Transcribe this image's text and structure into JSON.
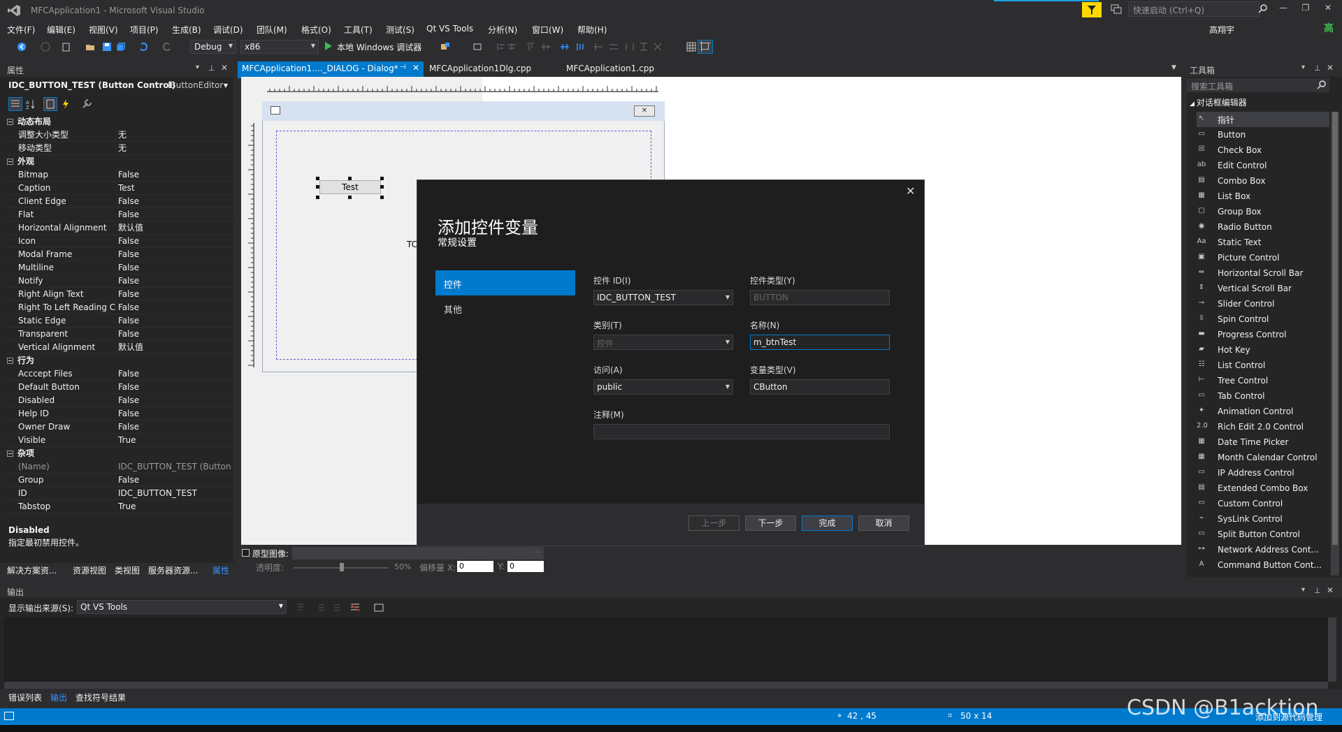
{
  "window": {
    "title": "MFCApplication1 - Microsoft Visual Studio",
    "quick_launch": "快速启动 (Ctrl+Q)",
    "user": "高翔宇",
    "avatar": "高"
  },
  "menu": [
    "文件(F)",
    "编辑(E)",
    "视图(V)",
    "项目(P)",
    "生成(B)",
    "调试(D)",
    "团队(M)",
    "格式(O)",
    "工具(T)",
    "测试(S)",
    "Qt VS Tools",
    "分析(N)",
    "窗口(W)",
    "帮助(H)"
  ],
  "toolbar": {
    "config": "Debug",
    "platform": "x86",
    "run": "本地 Windows 调试器"
  },
  "properties": {
    "header": "属性",
    "object": "IDC_BUTTON_TEST (Button Control)",
    "editor": "IButtonEditor",
    "categories": [
      {
        "name": "动态布局",
        "rows": [
          [
            "调整大小类型",
            "无"
          ],
          [
            "移动类型",
            "无"
          ]
        ]
      },
      {
        "name": "外观",
        "rows": [
          [
            "Bitmap",
            "False"
          ],
          [
            "Caption",
            "Test"
          ],
          [
            "Client Edge",
            "False"
          ],
          [
            "Flat",
            "False"
          ],
          [
            "Horizontal Alignment",
            "默认值"
          ],
          [
            "Icon",
            "False"
          ],
          [
            "Modal Frame",
            "False"
          ],
          [
            "Multiline",
            "False"
          ],
          [
            "Notify",
            "False"
          ],
          [
            "Right Align Text",
            "False"
          ],
          [
            "Right To Left Reading C",
            "False"
          ],
          [
            "Static Edge",
            "False"
          ],
          [
            "Transparent",
            "False"
          ],
          [
            "Vertical Alignment",
            "默认值"
          ]
        ]
      },
      {
        "name": "行为",
        "rows": [
          [
            "Acccept Files",
            "False"
          ],
          [
            "Default Button",
            "False"
          ],
          [
            "Disabled",
            "False"
          ],
          [
            "Help ID",
            "False"
          ],
          [
            "Owner Draw",
            "False"
          ],
          [
            "Visible",
            "True"
          ]
        ]
      },
      {
        "name": "杂项",
        "rows": [
          [
            "(Name)",
            "IDC_BUTTON_TEST (Button C"
          ],
          [
            "Group",
            "False"
          ],
          [
            "ID",
            "IDC_BUTTON_TEST"
          ],
          [
            "Tabstop",
            "True"
          ]
        ]
      }
    ],
    "desc_title": "Disabled",
    "desc_text": "指定最初禁用控件。",
    "bottom_tabs": [
      "解决方案资...",
      "资源视图",
      "类视图",
      "服务器资源...",
      "属性"
    ]
  },
  "tabs": [
    "MFCApplication1...._DIALOG - Dialog*",
    "MFCApplication1Dlg.cpp",
    "MFCApplication1.cpp"
  ],
  "design": {
    "button_caption": "Test",
    "todo_partial": "TC",
    "prototype_label": "原型图像:",
    "opacity_label": "透明度:",
    "opacity_value": "50%",
    "offset_x_label": "偏移量 X:",
    "offset_x": "0",
    "offset_y_label": "Y:",
    "offset_y": "0"
  },
  "modal": {
    "title": "添加控件变量",
    "subtitle": "常规设置",
    "nav": [
      "控件",
      "其他"
    ],
    "fields": {
      "control_id_label": "控件 ID(I)",
      "control_id": "IDC_BUTTON_TEST",
      "control_type_label": "控件类型(Y)",
      "control_type": "BUTTON",
      "category_label": "类别(T)",
      "category": "控件",
      "name_label": "名称(N)",
      "name": "m_btnTest",
      "access_label": "访问(A)",
      "access": "public",
      "var_type_label": "变量类型(V)",
      "var_type": "CButton",
      "comment_label": "注释(M)",
      "comment": ""
    },
    "buttons": [
      "上一步",
      "下一步",
      "完成",
      "取消"
    ]
  },
  "toolbox": {
    "header": "工具箱",
    "search": "搜索工具箱",
    "group": "对话框编辑器",
    "items": [
      "指针",
      "Button",
      "Check Box",
      "Edit Control",
      "Combo Box",
      "List Box",
      "Group Box",
      "Radio Button",
      "Static Text",
      "Picture Control",
      "Horizontal Scroll Bar",
      "Vertical Scroll Bar",
      "Slider Control",
      "Spin Control",
      "Progress Control",
      "Hot Key",
      "List Control",
      "Tree Control",
      "Tab Control",
      "Animation Control",
      "Rich Edit 2.0 Control",
      "Date Time Picker",
      "Month Calendar Control",
      "IP Address Control",
      "Extended Combo Box",
      "Custom Control",
      "SysLink Control",
      "Split Button Control",
      "Network Address Cont...",
      "Command Button Cont..."
    ]
  },
  "output": {
    "header": "输出",
    "source_label": "显示输出来源(S):",
    "source": "Qt VS Tools",
    "tabs": [
      "错误列表",
      "输出",
      "查找符号结果"
    ]
  },
  "status": {
    "position": "42 , 45",
    "size": "50 x 14",
    "add_source": "添加到源代码管理"
  },
  "watermark": "CSDN @B1acktion"
}
